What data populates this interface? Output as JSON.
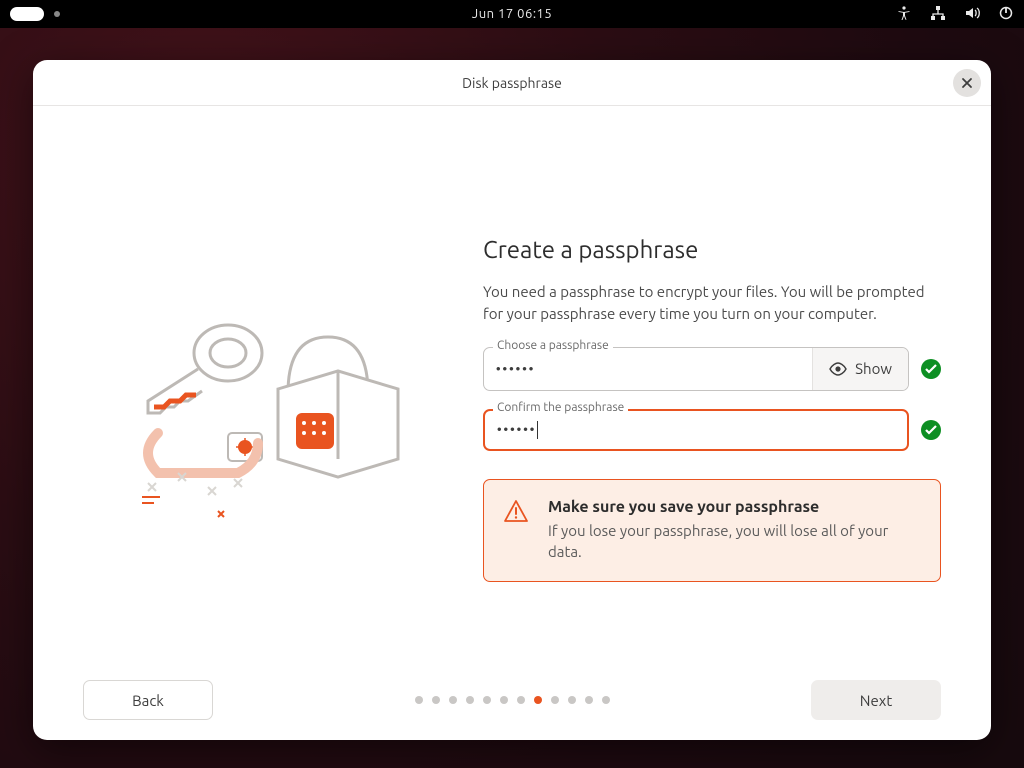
{
  "topbar": {
    "clock": "Jun 17   06:15"
  },
  "window": {
    "title": "Disk passphrase"
  },
  "page": {
    "heading": "Create a passphrase",
    "description": "You need a passphrase to encrypt your files. You will be prompted for your passphrase every time you turn on your computer.",
    "field1_label": "Choose a passphrase",
    "field1_value": "••••••",
    "show_label": "Show",
    "field2_label": "Confirm the passphrase",
    "field2_value": "••••••",
    "warning_title": "Make sure you save your passphrase",
    "warning_body": "If you lose your passphrase, you will lose all of your data."
  },
  "footer": {
    "back": "Back",
    "next": "Next",
    "total_steps": 12,
    "active_step": 8
  },
  "colors": {
    "accent": "#e95420",
    "success": "#0d8f23"
  }
}
